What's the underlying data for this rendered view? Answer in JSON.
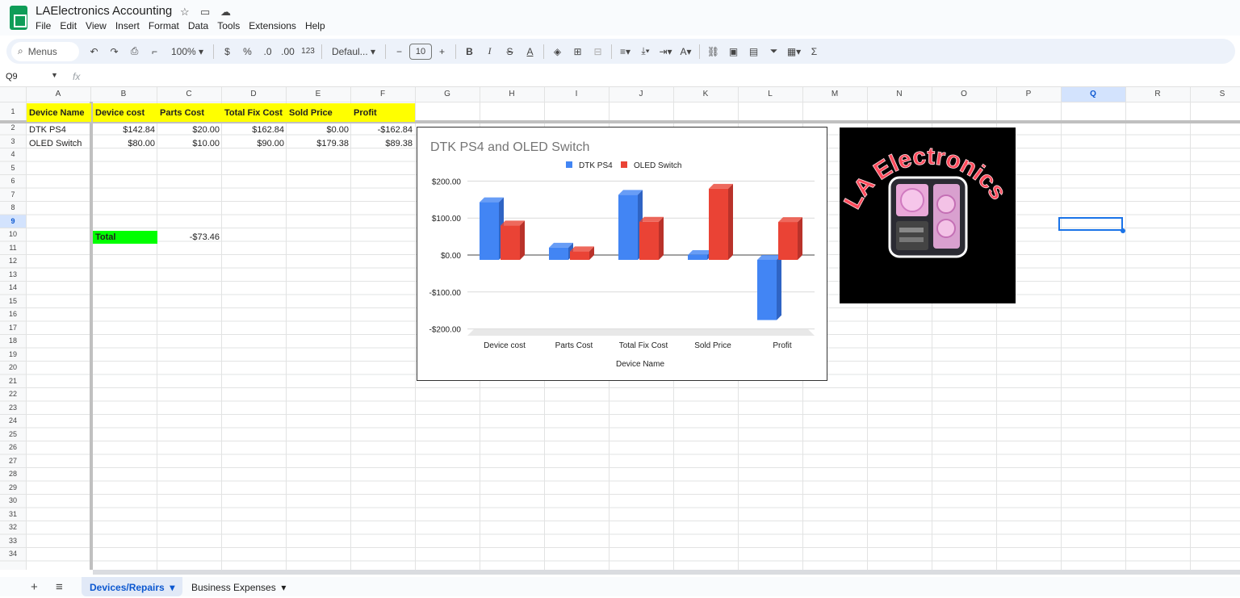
{
  "app": {
    "title": "LAElectronics Accounting"
  },
  "menus": [
    "File",
    "Edit",
    "View",
    "Insert",
    "Format",
    "Data",
    "Tools",
    "Extensions",
    "Help"
  ],
  "toolbar": {
    "search_label": "Menus",
    "zoom": "100%",
    "currency": "$",
    "percent": "%",
    "dec_decrease": ".0",
    "dec_increase": ".00",
    "number_format": "123",
    "font": "Defaul...",
    "font_size": "10"
  },
  "formula_bar": {
    "name_box": "Q9",
    "fx": "fx",
    "value": ""
  },
  "columns": [
    "A",
    "B",
    "C",
    "D",
    "E",
    "F",
    "G",
    "H",
    "I",
    "J",
    "K",
    "L",
    "M",
    "N",
    "O",
    "P",
    "Q",
    "R",
    "S"
  ],
  "rows": [
    "1",
    "2",
    "3",
    "4",
    "5",
    "6",
    "7",
    "8",
    "9",
    "10",
    "11",
    "12",
    "13",
    "14",
    "15",
    "16",
    "17",
    "18",
    "19",
    "20",
    "21",
    "22",
    "23",
    "24",
    "25",
    "26",
    "27",
    "28",
    "29",
    "30",
    "31",
    "32",
    "33",
    "34"
  ],
  "table": {
    "headers": [
      "Device Name",
      "Device cost",
      "Parts Cost",
      "Total Fix Cost",
      "Sold Price",
      "Profit"
    ],
    "rows": [
      [
        "DTK PS4",
        "$142.84",
        "$20.00",
        "$162.84",
        "$0.00",
        "-$162.84"
      ],
      [
        "OLED Switch",
        "$80.00",
        "$10.00",
        "$90.00",
        "$179.38",
        "$89.38"
      ]
    ],
    "total_label": "Total",
    "total_value": "-$73.46"
  },
  "chart_data": {
    "type": "bar",
    "title": "DTK PS4 and OLED Switch",
    "xlabel": "Device Name",
    "ylabel": "",
    "categories": [
      "Device cost",
      "Parts Cost",
      "Total Fix Cost",
      "Sold Price",
      "Profit"
    ],
    "series": [
      {
        "name": "DTK PS4",
        "values": [
          142.84,
          20.0,
          162.84,
          0.0,
          -162.84
        ],
        "color": "#4285f4"
      },
      {
        "name": "OLED Switch",
        "values": [
          80.0,
          10.0,
          90.0,
          179.38,
          89.38
        ],
        "color": "#ea4335"
      }
    ],
    "y_ticks": [
      "$200.00",
      "$100.00",
      "$0.00",
      "-$100.00",
      "-$200.00"
    ],
    "ylim": [
      -200,
      200
    ],
    "legend": "top",
    "grid": true
  },
  "image": {
    "text": "LA Electronics"
  },
  "sheet_tabs": [
    {
      "label": "Devices/Repairs",
      "active": true
    },
    {
      "label": "Business Expenses",
      "active": false
    }
  ],
  "colors": {
    "header_fill": "#ffff00",
    "total_fill": "#00ff00",
    "selection": "#1a73e8"
  }
}
